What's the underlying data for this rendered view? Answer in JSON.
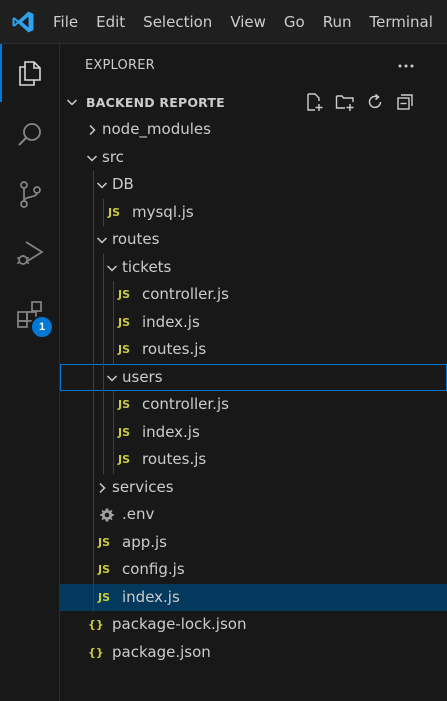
{
  "window": {
    "menu": [
      "File",
      "Edit",
      "Selection",
      "View",
      "Go",
      "Run",
      "Terminal"
    ]
  },
  "activity_bar": {
    "items": [
      {
        "icon": "files-icon",
        "active": true
      },
      {
        "icon": "search-icon",
        "active": false
      },
      {
        "icon": "source-control-icon",
        "active": false
      },
      {
        "icon": "run-debug-icon",
        "active": false
      },
      {
        "icon": "extensions-icon",
        "active": false,
        "badge": "1"
      }
    ]
  },
  "sidebar": {
    "title": "EXPLORER",
    "more_label": "···",
    "section": {
      "title": "BACKEND REPORTE",
      "actions": [
        "new-file-icon",
        "new-folder-icon",
        "refresh-icon",
        "collapse-all-icon"
      ]
    },
    "tree": [
      {
        "label": "node_modules",
        "type": "folder",
        "expanded": false,
        "depth": 0
      },
      {
        "label": "src",
        "type": "folder",
        "expanded": true,
        "depth": 0
      },
      {
        "label": "DB",
        "type": "folder",
        "expanded": true,
        "depth": 1
      },
      {
        "label": "mysql.js",
        "type": "js",
        "icon": "JS",
        "depth": 2
      },
      {
        "label": "routes",
        "type": "folder",
        "expanded": true,
        "depth": 1
      },
      {
        "label": "tickets",
        "type": "folder",
        "expanded": true,
        "depth": 2
      },
      {
        "label": "controller.js",
        "type": "js",
        "icon": "JS",
        "depth": 3
      },
      {
        "label": "index.js",
        "type": "js",
        "icon": "JS",
        "depth": 3
      },
      {
        "label": "routes.js",
        "type": "js",
        "icon": "JS",
        "depth": 3
      },
      {
        "label": "users",
        "type": "folder",
        "expanded": true,
        "depth": 2,
        "focused": true
      },
      {
        "label": "controller.js",
        "type": "js",
        "icon": "JS",
        "depth": 3
      },
      {
        "label": "index.js",
        "type": "js",
        "icon": "JS",
        "depth": 3
      },
      {
        "label": "routes.js",
        "type": "js",
        "icon": "JS",
        "depth": 3
      },
      {
        "label": "services",
        "type": "folder",
        "expanded": false,
        "depth": 1
      },
      {
        "label": ".env",
        "type": "env",
        "depth": 1
      },
      {
        "label": "app.js",
        "type": "js",
        "icon": "JS",
        "depth": 1
      },
      {
        "label": "config.js",
        "type": "js",
        "icon": "JS",
        "depth": 1
      },
      {
        "label": "index.js",
        "type": "js",
        "icon": "JS",
        "depth": 1,
        "selected": true
      },
      {
        "label": "package-lock.json",
        "type": "json",
        "icon": "{}",
        "depth": 0
      },
      {
        "label": "package.json",
        "type": "json",
        "icon": "{}",
        "depth": 0
      }
    ]
  },
  "colors": {
    "accent": "#0078d4",
    "js_icon": "#cbcb41",
    "selected_row": "#04395e"
  }
}
